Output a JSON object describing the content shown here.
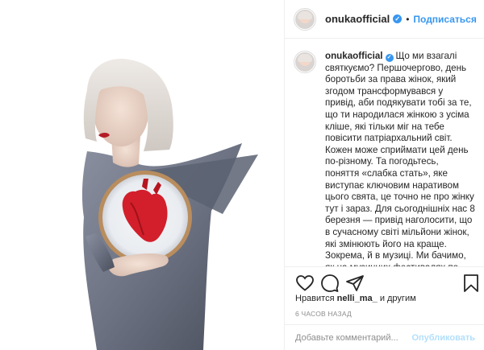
{
  "post": {
    "username": "onukaofficial",
    "verified_icon": "verified-badge-icon",
    "separator": "•",
    "follow_label": "Подписаться"
  },
  "caption": {
    "username": "onukaofficial",
    "text": "Що ми взагалі святкуємо? Першочергово, день боротьби за права жінок, який згодом трансформувався у привід, аби подякувати тобі за те, що ти народилася жінкою з усіма кліше, які тільки міг на тебе повісити патріархальний світ. Кожен може сприймати цей день по-різному. Та погодьтесь, поняття «слабка стать», яке виступає ключовим наративом цього свята, це точно не про жінку тут і зараз. Для сьогоднішніх нас 8 березня — привід наголосити, що в сучасному світі мільйони жінок, які змінюють його на краще. Зокрема, й в музиці. Ми бачимо, як на музичних фестивалях по всьому світі дійсно домінують артисти чоловічої статі,"
  },
  "actions": {
    "icons": [
      "heart-icon",
      "comment-icon",
      "share-icon",
      "bookmark-icon"
    ]
  },
  "likes": {
    "prefix": "Нравится",
    "user": "nelli_ma_",
    "suffix": "и другим"
  },
  "timestamp": "6 часов назад",
  "comment": {
    "placeholder": "Добавьте комментарий...",
    "publish_label": "Опубликовать"
  },
  "colors": {
    "accent": "#3897f0",
    "publish_disabled": "#b2dffc",
    "border": "#efefef",
    "muted": "#8e8e8e",
    "dress": "#6f7584",
    "heart": "#d21f2b"
  }
}
